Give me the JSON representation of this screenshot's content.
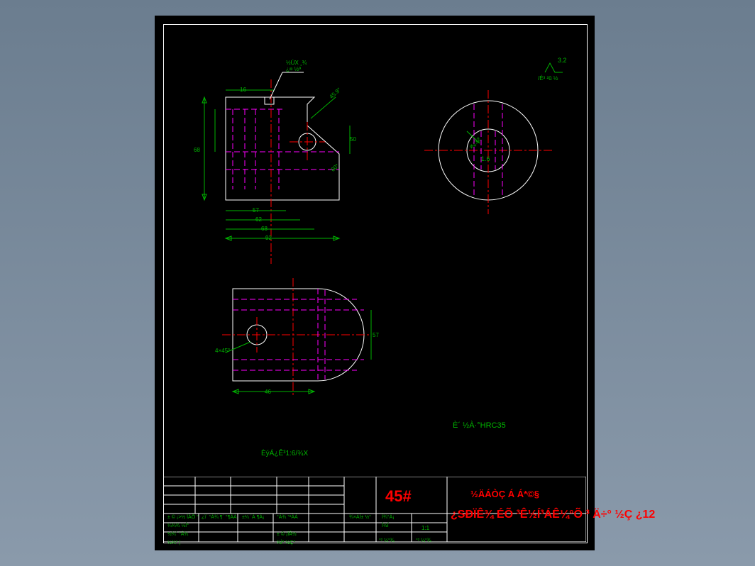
{
  "notes": {
    "topLeader": "½ÚX ¸¾",
    "topLeader2": "¿¤ ½ª",
    "topRightSurface": "3.2",
    "topRightLabel": "/É³ ²û ½",
    "angleTop": "45.9°",
    "circleDiam": "ø¿32",
    "circleRad": "1.6",
    "dimA": "16",
    "angleMid": "60°",
    "dimB": "50",
    "dimC": "57",
    "dimD": "62",
    "dimE": "68",
    "dimF": "92",
    "viewBAngle": "4×45°",
    "viewBDim": "57",
    "viewBBase": "46",
    "hardness": "È´ ½À·°HRC35",
    "bottomNote": "ÈýÁ¿Ê³1:6/¾X"
  },
  "title": {
    "mat": "45#",
    "school": "½ÄÁÒÇ Á Á*©§",
    "project": "¿SÐÏÊ¾ ÉÕ ³Ê½Í³ÁÊ¼°Õ ³ Ä÷° ½Ç ¿12",
    "row1c1": "± © ¡>½ ÏÂÕ °",
    "row1c2": "¿ì´ °Á¾ ¶´ °¶ÀÀ",
    "row1c3": "±¼ ´Á ¶Á¡",
    "row1c4": "°Á¾ °²ÀÁ",
    "row1c5": "¾×ÀÍ± ½°",
    "row1c6": "Í¾°Á¡",
    "row2a": "¼¾¾ ½Í°",
    "row2b": "Í½Í",
    "row3a": "½¾´ °Á¾",
    "row3b": "± © ¡ÏÂ½",
    "row4a": "½¾° ¦",
    "row4b": "¾Ì° ½Ç°",
    "scale": "1:1",
    "sheet1": "°²    ¼°¾",
    "sheet2": "°²    ¼°¾"
  }
}
